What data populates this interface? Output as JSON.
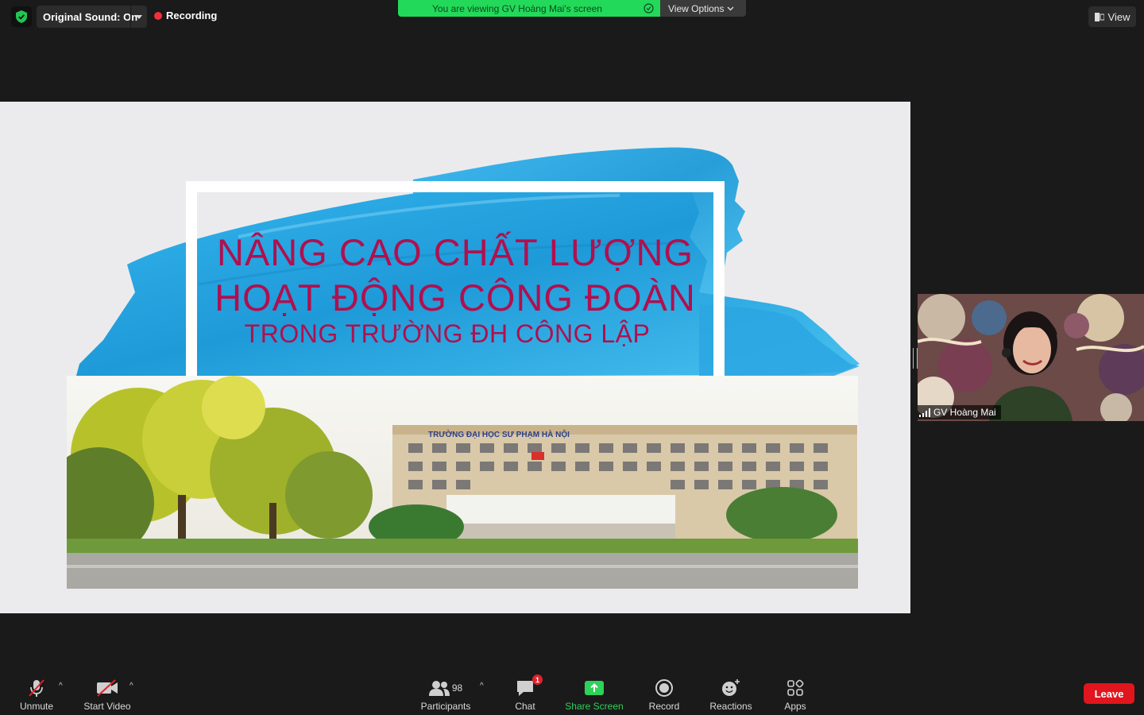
{
  "topbar": {
    "original_sound": "Original Sound: On",
    "recording": "Recording",
    "viewing_banner": "You are viewing GV Hoàng Mai's screen",
    "view_options": "View Options",
    "view": "View"
  },
  "slide": {
    "title_line1": "NÂNG CAO CHẤT LƯỢNG",
    "title_line2": "HOẠT ĐỘNG CÔNG ĐOÀN",
    "subtitle": "TRONG TRƯỜNG ĐH CÔNG LẬP",
    "building_sign": "TRƯỜNG ĐẠI HỌC SƯ PHẠM HÀ NỘI"
  },
  "speaker": {
    "name": "GV Hoàng Mai"
  },
  "toolbar": {
    "unmute": "Unmute",
    "start_video": "Start Video",
    "participants": "Participants",
    "participants_count": "98",
    "chat": "Chat",
    "chat_badge": "1",
    "share_screen": "Share Screen",
    "record": "Record",
    "reactions": "Reactions",
    "apps": "Apps",
    "leave": "Leave"
  },
  "colors": {
    "accent_green": "#23d959",
    "title_magenta": "#b0104e",
    "brush_blue": "#2aa2e0",
    "leave_red": "#e0151d"
  },
  "icons": [
    "shield-icon",
    "chevron-down-icon",
    "record-dot-icon",
    "view-icon",
    "microphone-muted-icon",
    "video-muted-icon",
    "participants-icon",
    "chat-icon",
    "share-screen-icon",
    "record-icon",
    "reactions-icon",
    "apps-icon",
    "signal-icon"
  ]
}
